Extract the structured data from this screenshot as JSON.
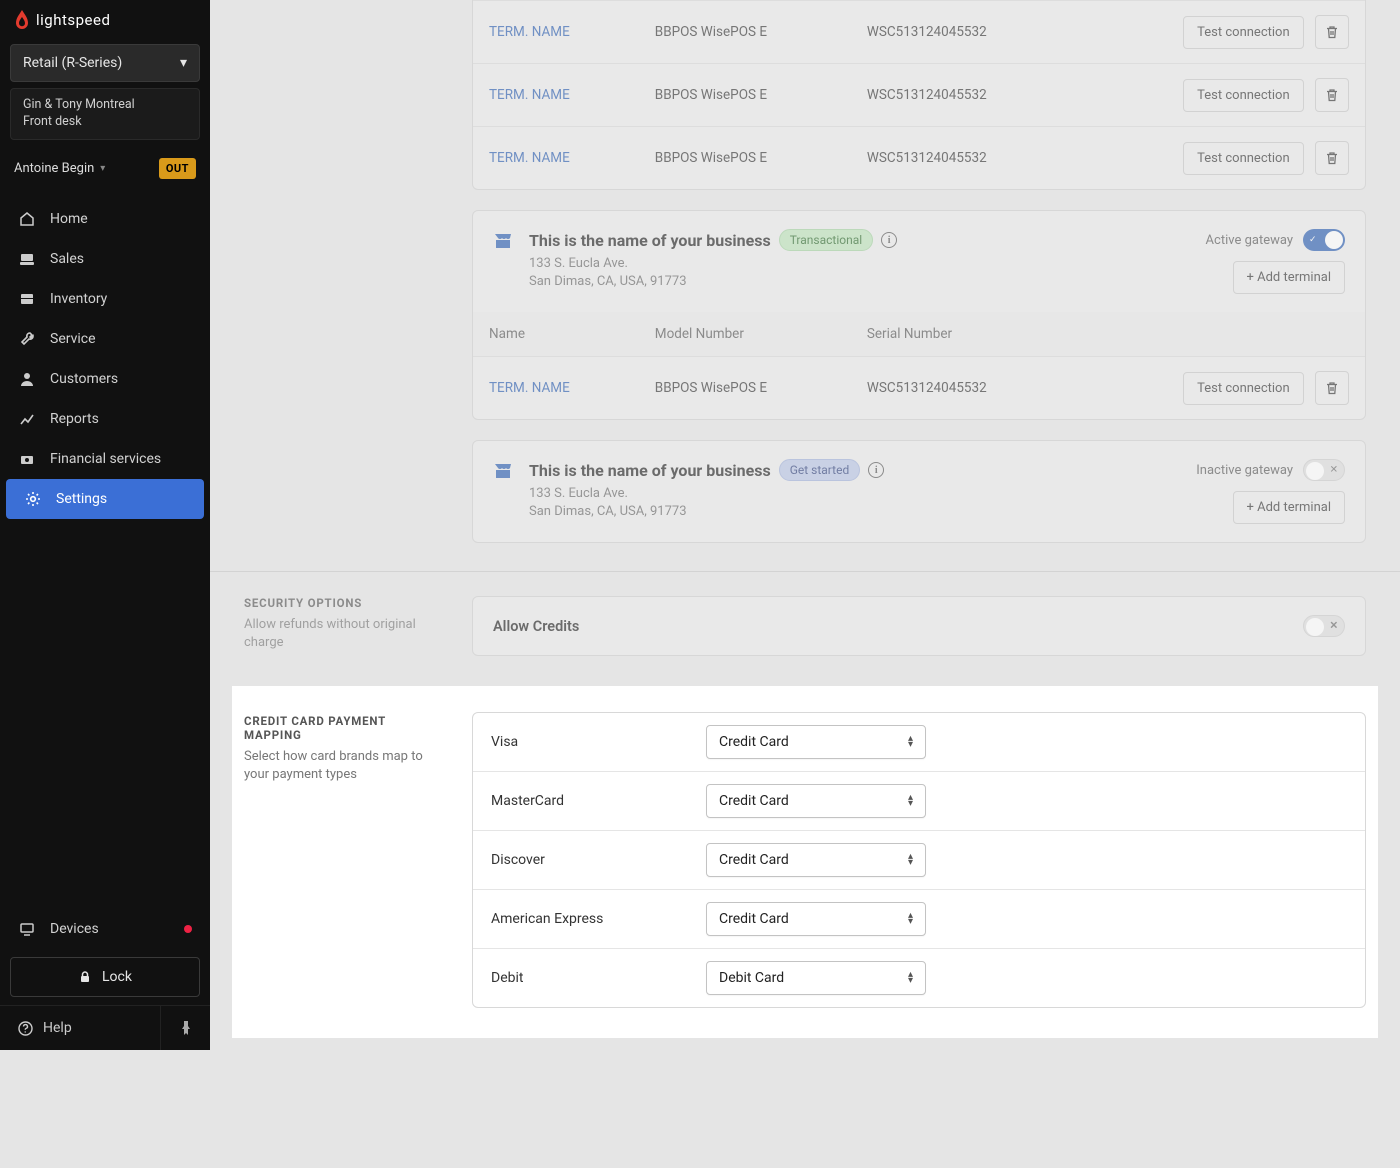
{
  "brand": "lightspeed",
  "series_selector": "Retail (R-Series)",
  "location": {
    "line1": "Gin & Tony Montreal",
    "line2": "Front desk"
  },
  "user": {
    "name": "Antoine Begin",
    "status_badge": "OUT"
  },
  "nav": {
    "home": "Home",
    "sales": "Sales",
    "inventory": "Inventory",
    "service": "Service",
    "customers": "Customers",
    "reports": "Reports",
    "financial": "Financial services",
    "settings": "Settings"
  },
  "devices_label": "Devices",
  "lock_label": "Lock",
  "help_label": "Help",
  "top_terminals": [
    {
      "name": "TERM. NAME",
      "model": "BBPOS WisePOS E",
      "serial": "WSC513124045532"
    },
    {
      "name": "TERM. NAME",
      "model": "BBPOS WisePOS E",
      "serial": "WSC513124045532"
    },
    {
      "name": "TERM. NAME",
      "model": "BBPOS WisePOS E",
      "serial": "WSC513124045532"
    }
  ],
  "test_connection_label": "Test connection",
  "biz1": {
    "title": "This is the name of your business",
    "badge": "Transactional",
    "addr1": "133 S. Eucla Ave.",
    "addr2": "San Dimas, CA, USA, 91773",
    "gateway_label": "Active gateway",
    "add_terminal": "+ Add terminal",
    "columns": {
      "name": "Name",
      "model": "Model Number",
      "serial": "Serial Number"
    },
    "rows": [
      {
        "name": "TERM. NAME",
        "model": "BBPOS WisePOS E",
        "serial": "WSC513124045532"
      }
    ]
  },
  "biz2": {
    "title": "This is the name of your business",
    "badge": "Get started",
    "addr1": "133 S. Eucla Ave.",
    "addr2": "San Dimas, CA, USA, 91773",
    "gateway_label": "Inactive gateway",
    "add_terminal": "+ Add terminal"
  },
  "security": {
    "heading": "SECURITY OPTIONS",
    "desc": "Allow refunds without original charge",
    "allow_credits": "Allow Credits"
  },
  "mapping": {
    "heading": "CREDIT CARD PAYMENT MAPPING",
    "desc": "Select how card brands map to your payment types",
    "rows": [
      {
        "brand": "Visa",
        "value": "Credit Card"
      },
      {
        "brand": "MasterCard",
        "value": "Credit Card"
      },
      {
        "brand": "Discover",
        "value": "Credit Card"
      },
      {
        "brand": "American Express",
        "value": "Credit Card"
      },
      {
        "brand": "Debit",
        "value": "Debit Card"
      }
    ]
  }
}
